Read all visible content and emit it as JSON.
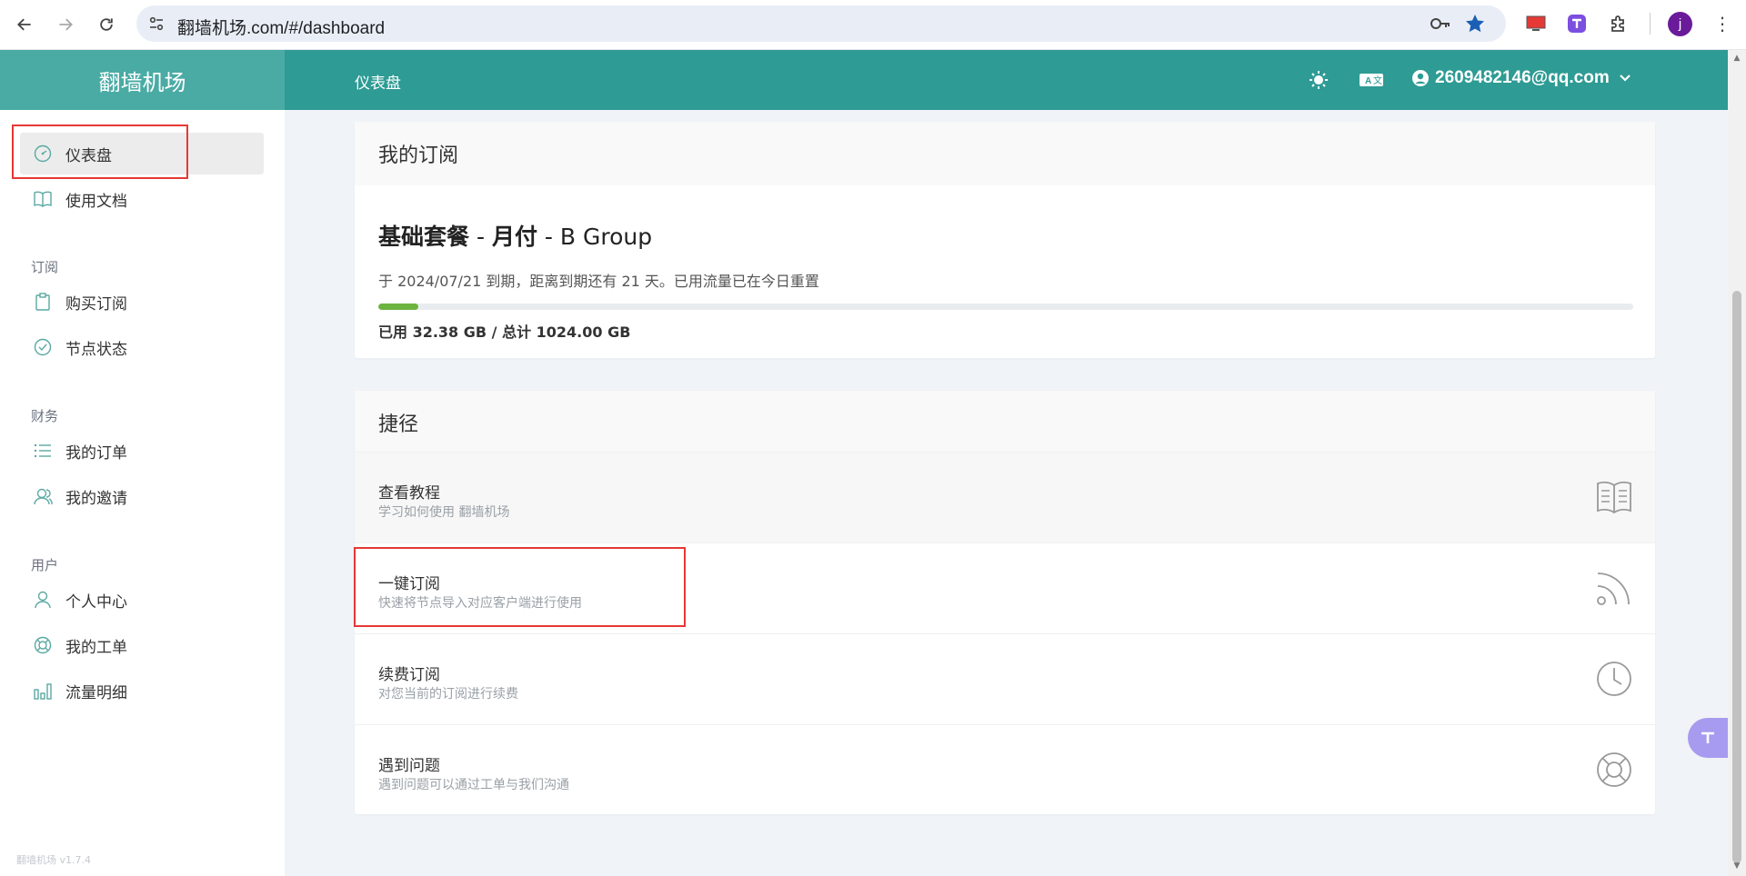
{
  "browser": {
    "url": "翻墙机场.com/#/dashboard",
    "profile_initial": "j"
  },
  "header": {
    "brand": "翻墙机场",
    "title": "仪表盘",
    "user_email": "2609482146@qq.com"
  },
  "sidebar": {
    "items": [
      {
        "label": "仪表盘",
        "icon": "dashboard-gauge-icon"
      },
      {
        "label": "使用文档",
        "icon": "book-icon"
      }
    ],
    "groups": [
      {
        "title": "订阅",
        "items": [
          {
            "label": "购买订阅",
            "icon": "clipboard-icon"
          },
          {
            "label": "节点状态",
            "icon": "check-circle-icon"
          }
        ]
      },
      {
        "title": "财务",
        "items": [
          {
            "label": "我的订单",
            "icon": "list-icon"
          },
          {
            "label": "我的邀请",
            "icon": "users-icon"
          }
        ]
      },
      {
        "title": "用户",
        "items": [
          {
            "label": "个人中心",
            "icon": "user-icon"
          },
          {
            "label": "我的工单",
            "icon": "lifebuoy-icon"
          },
          {
            "label": "流量明细",
            "icon": "bar-chart-icon"
          }
        ]
      }
    ],
    "version": "翻墙机场 v1.7.4"
  },
  "subscription": {
    "heading": "我的订阅",
    "plan_base": "基础套餐",
    "plan_sep1": " - ",
    "plan_cycle": "月付",
    "plan_group": " - B Group",
    "expiry_text": "于 2024/07/21 到期，距离到期还有 21 天。已用流量已在今日重置",
    "usage_text": "已用 32.38 GB / 总计 1024.00 GB",
    "used_gb": 32.38,
    "total_gb": 1024.0
  },
  "shortcuts": {
    "heading": "捷径",
    "items": [
      {
        "title": "查看教程",
        "desc": "学习如何使用 翻墙机场",
        "icon": "book-open-icon"
      },
      {
        "title": "一键订阅",
        "desc": "快速将节点导入对应客户端进行使用",
        "icon": "rss-icon"
      },
      {
        "title": "续费订阅",
        "desc": "对您当前的订阅进行续费",
        "icon": "clock-icon"
      },
      {
        "title": "遇到问题",
        "desc": "遇到问题可以通过工单与我们沟通",
        "icon": "lifebuoy-icon"
      }
    ]
  },
  "colors": {
    "header": "#2e9b94",
    "brand_box": "#4aaba4",
    "progress": "#6db33f",
    "highlight": "#e53935"
  }
}
